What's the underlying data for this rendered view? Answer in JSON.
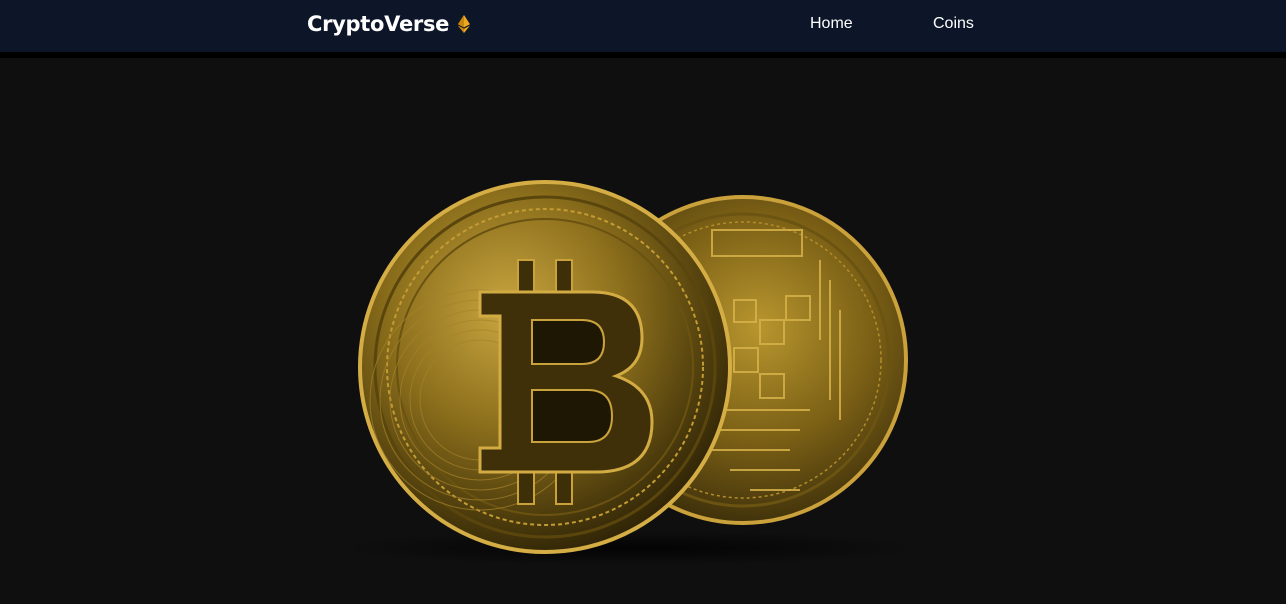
{
  "navbar": {
    "brand": "CryptoVerse",
    "brand_icon": "ethereum-icon",
    "links": [
      {
        "label": "Home"
      },
      {
        "label": "Coins"
      }
    ]
  },
  "hero": {
    "image": "bitcoin-coins-illustration"
  },
  "colors": {
    "navbar_bg": "#0d1628",
    "page_bg": "#0f0f0f",
    "accent_gold": "#e8a317",
    "text": "#ffffff"
  }
}
